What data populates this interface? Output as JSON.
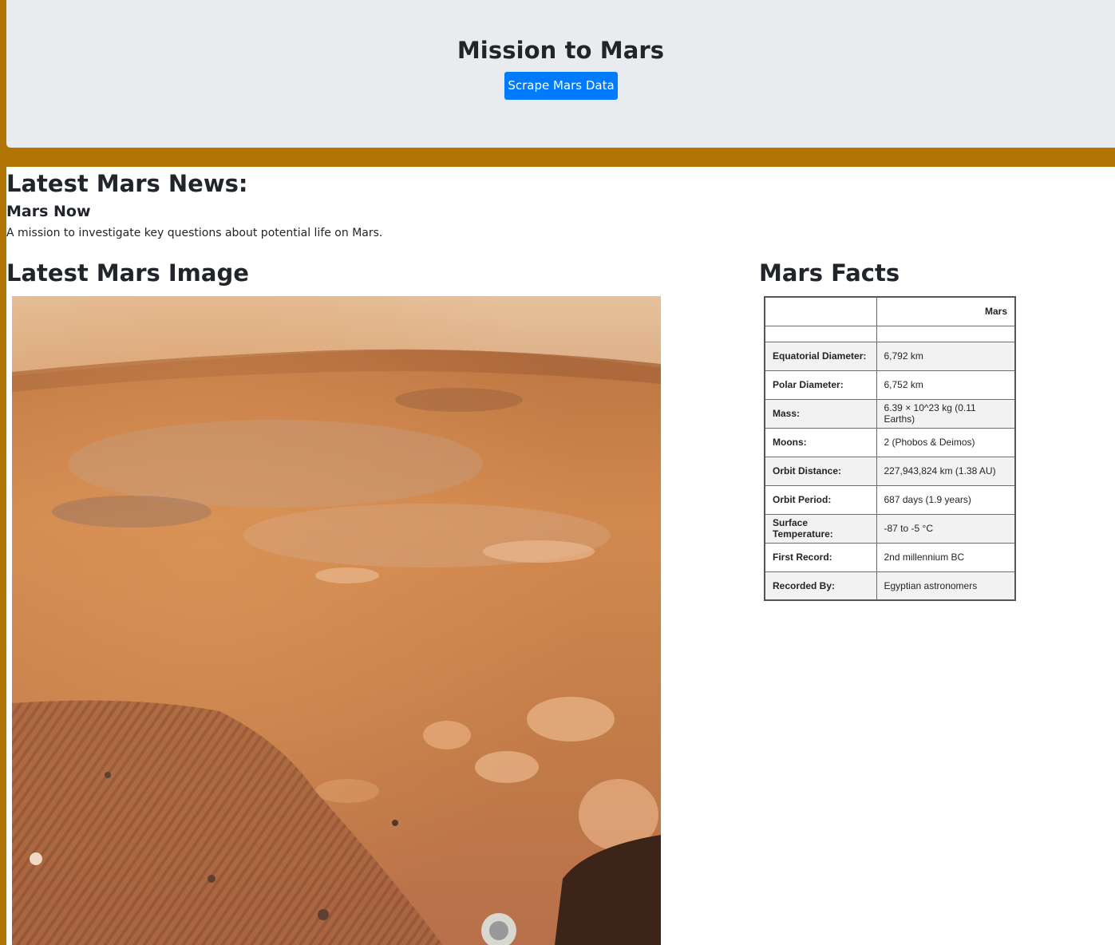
{
  "header": {
    "title": "Mission to Mars",
    "scrape_button_label": "Scrape Mars Data"
  },
  "news": {
    "heading": "Latest Mars News:",
    "title": "Mars Now",
    "teaser": "A mission to investigate key questions about potential life on Mars."
  },
  "image_section": {
    "heading": "Latest Mars Image"
  },
  "facts": {
    "heading": "Mars Facts",
    "column_header": "Mars",
    "rows": [
      {
        "label": "Equatorial Diameter:",
        "value": "6,792 km"
      },
      {
        "label": "Polar Diameter:",
        "value": "6,752 km"
      },
      {
        "label": "Mass:",
        "value": "6.39 × 10^23 kg (0.11 Earths)"
      },
      {
        "label": "Moons:",
        "value": "2 (Phobos & Deimos)"
      },
      {
        "label": "Orbit Distance:",
        "value": "227,943,824 km (1.38 AU)"
      },
      {
        "label": "Orbit Period:",
        "value": "687 days (1.9 years)"
      },
      {
        "label": "Surface Temperature:",
        "value": "-87 to -5 °C"
      },
      {
        "label": "First Record:",
        "value": "2nd millennium BC"
      },
      {
        "label": "Recorded By:",
        "value": "Egyptian astronomers"
      }
    ]
  },
  "colors": {
    "page_border": "#b27503",
    "jumbotron_bg": "#e9ecef",
    "button_bg": "#007bff"
  }
}
